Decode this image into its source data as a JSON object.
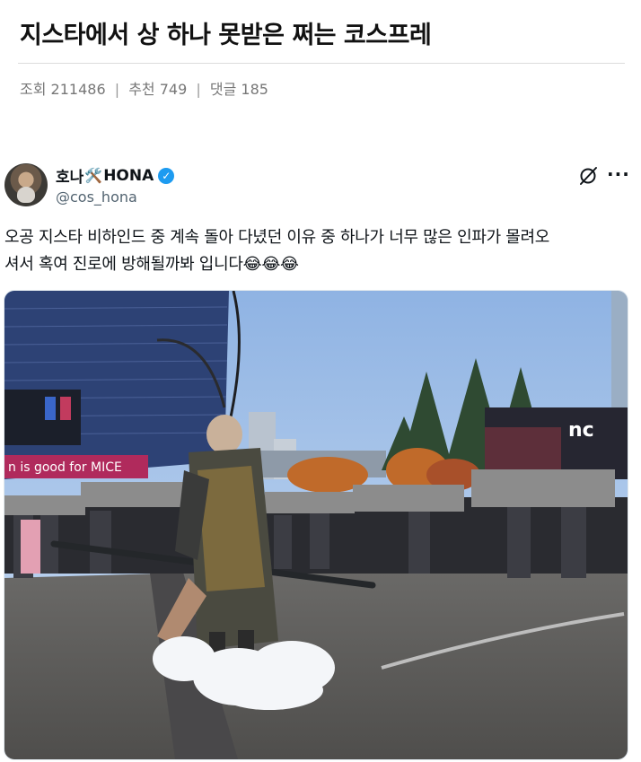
{
  "post": {
    "title": "지스타에서 상 하나 못받은 쩌는 코스프레",
    "views_label": "조회",
    "views": "211486",
    "recommend_label": "추천",
    "recommend": "749",
    "comments_label": "댓글",
    "comments": "185",
    "separator": "|"
  },
  "tweet": {
    "name_prefix": "호나",
    "name_emoji": "🛠️",
    "name_suffix": "HONA",
    "handle": "@cos_hona",
    "text_line1": "오공 지스타 비하인드 중 계속 돌아 다녔던 이유 중 하나가 너무 많은 인파가 몰려오",
    "text_line2": "셔서 혹여 진로에 방해될까봐 입니다",
    "emojis": "😂😂😂",
    "verified_icon": "check-badge-icon",
    "more_icon": "ellipsis-icon",
    "grok_icon": "grok-slash-icon"
  },
  "photo": {
    "signs": {
      "left": "n is good for MICE",
      "board": "nc"
    },
    "colors": {
      "sky": "#9fc0e8",
      "ground": "#5e5d5b",
      "building": "#2c3f6a"
    }
  }
}
